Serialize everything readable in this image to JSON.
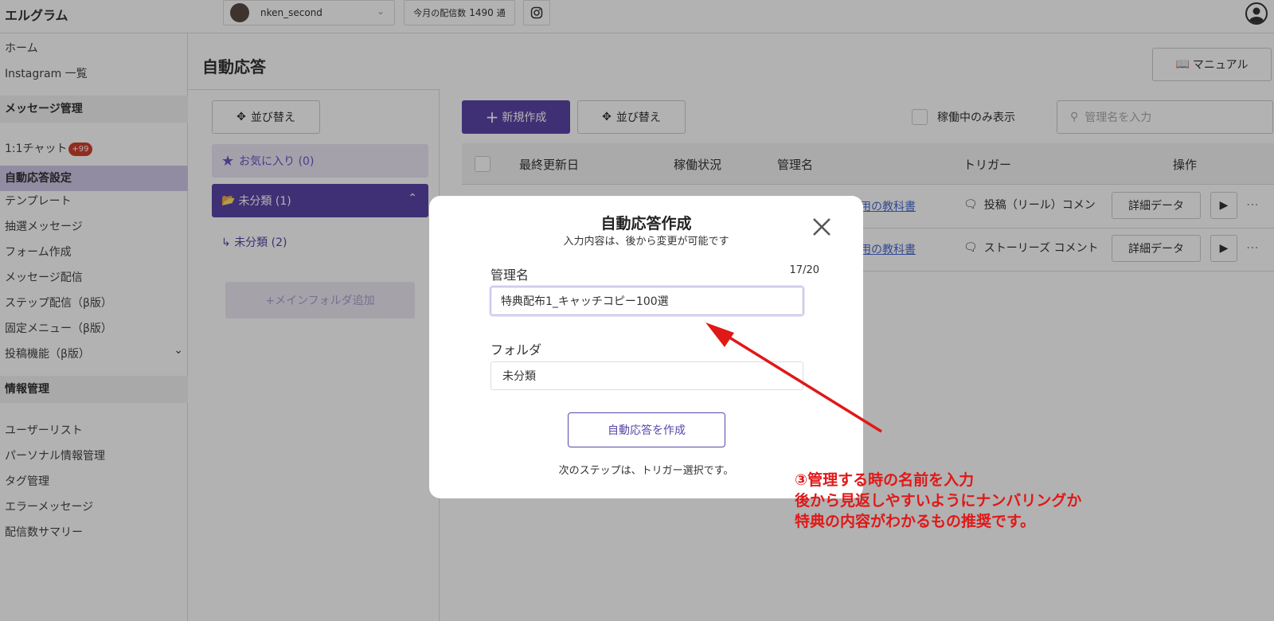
{
  "app": {
    "brand": "エルグラム"
  },
  "topbar": {
    "account_name": "nken_second",
    "delivery_label": "今月の配信数",
    "delivery_count": "1490",
    "delivery_unit": "通"
  },
  "sidebar": {
    "home": "ホーム",
    "instagram_list": "Instagram 一覧",
    "section_message": "メッセージ管理",
    "chat": "1:1チャット",
    "chat_badge": "+99",
    "auto_reply": "自動応答設定",
    "template": "テンプレート",
    "lottery": "抽選メッセージ",
    "form": "フォーム作成",
    "message_delivery": "メッセージ配信",
    "step_delivery": "ステップ配信（β版）",
    "fixed_menu": "固定メニュー（β版）",
    "post_feature": "投稿機能（β版）",
    "section_info": "情報管理",
    "user_list": "ユーザーリスト",
    "personal_info": "パーソナル情報管理",
    "tag_mgmt": "タグ管理",
    "error_message": "エラーメッセージ",
    "delivery_summary": "配信数サマリー"
  },
  "main": {
    "title": "自動応答",
    "manual_label": "マニュアル",
    "sort_label": "並び替え",
    "favorites": "お気に入り (0)",
    "unclassified": "未分類 (1)",
    "sub_unclassified": "未分類 (2)",
    "add_main_folder": "+メインフォルダ追加",
    "new_label": "新規作成",
    "active_only": "稼働中のみ表示",
    "search_placeholder": "管理名を入力"
  },
  "table": {
    "headers": [
      "最終更新日",
      "稼働状況",
      "管理名",
      "トリガー",
      "操作"
    ],
    "rows": [
      {
        "name": "用の教科書",
        "trigger": "投稿（リール）コメン",
        "detail": "詳細データ"
      },
      {
        "name": "用の教科書",
        "trigger": "ストーリーズ コメント",
        "detail": "詳細データ"
      }
    ]
  },
  "modal": {
    "title": "自動応答作成",
    "subtitle": "入力内容は、後から変更が可能です",
    "name_label": "管理名",
    "counter": "17/20",
    "name_value": "特典配布1_キャッチコピー100選",
    "folder_label": "フォルダ",
    "folder_value": "未分類",
    "create_label": "自動応答を作成",
    "note": "次のステップは、トリガー選択です。"
  },
  "annotation": {
    "line1": "③管理する時の名前を入力",
    "line2": "後から見返しやすいようにナンバリングか",
    "line3": "特典の内容がわかるもの推奨です。",
    "color": "#e01818"
  },
  "colors": {
    "accent": "#5b46a8",
    "badge": "#d0402e",
    "link": "#4a6ad2"
  }
}
